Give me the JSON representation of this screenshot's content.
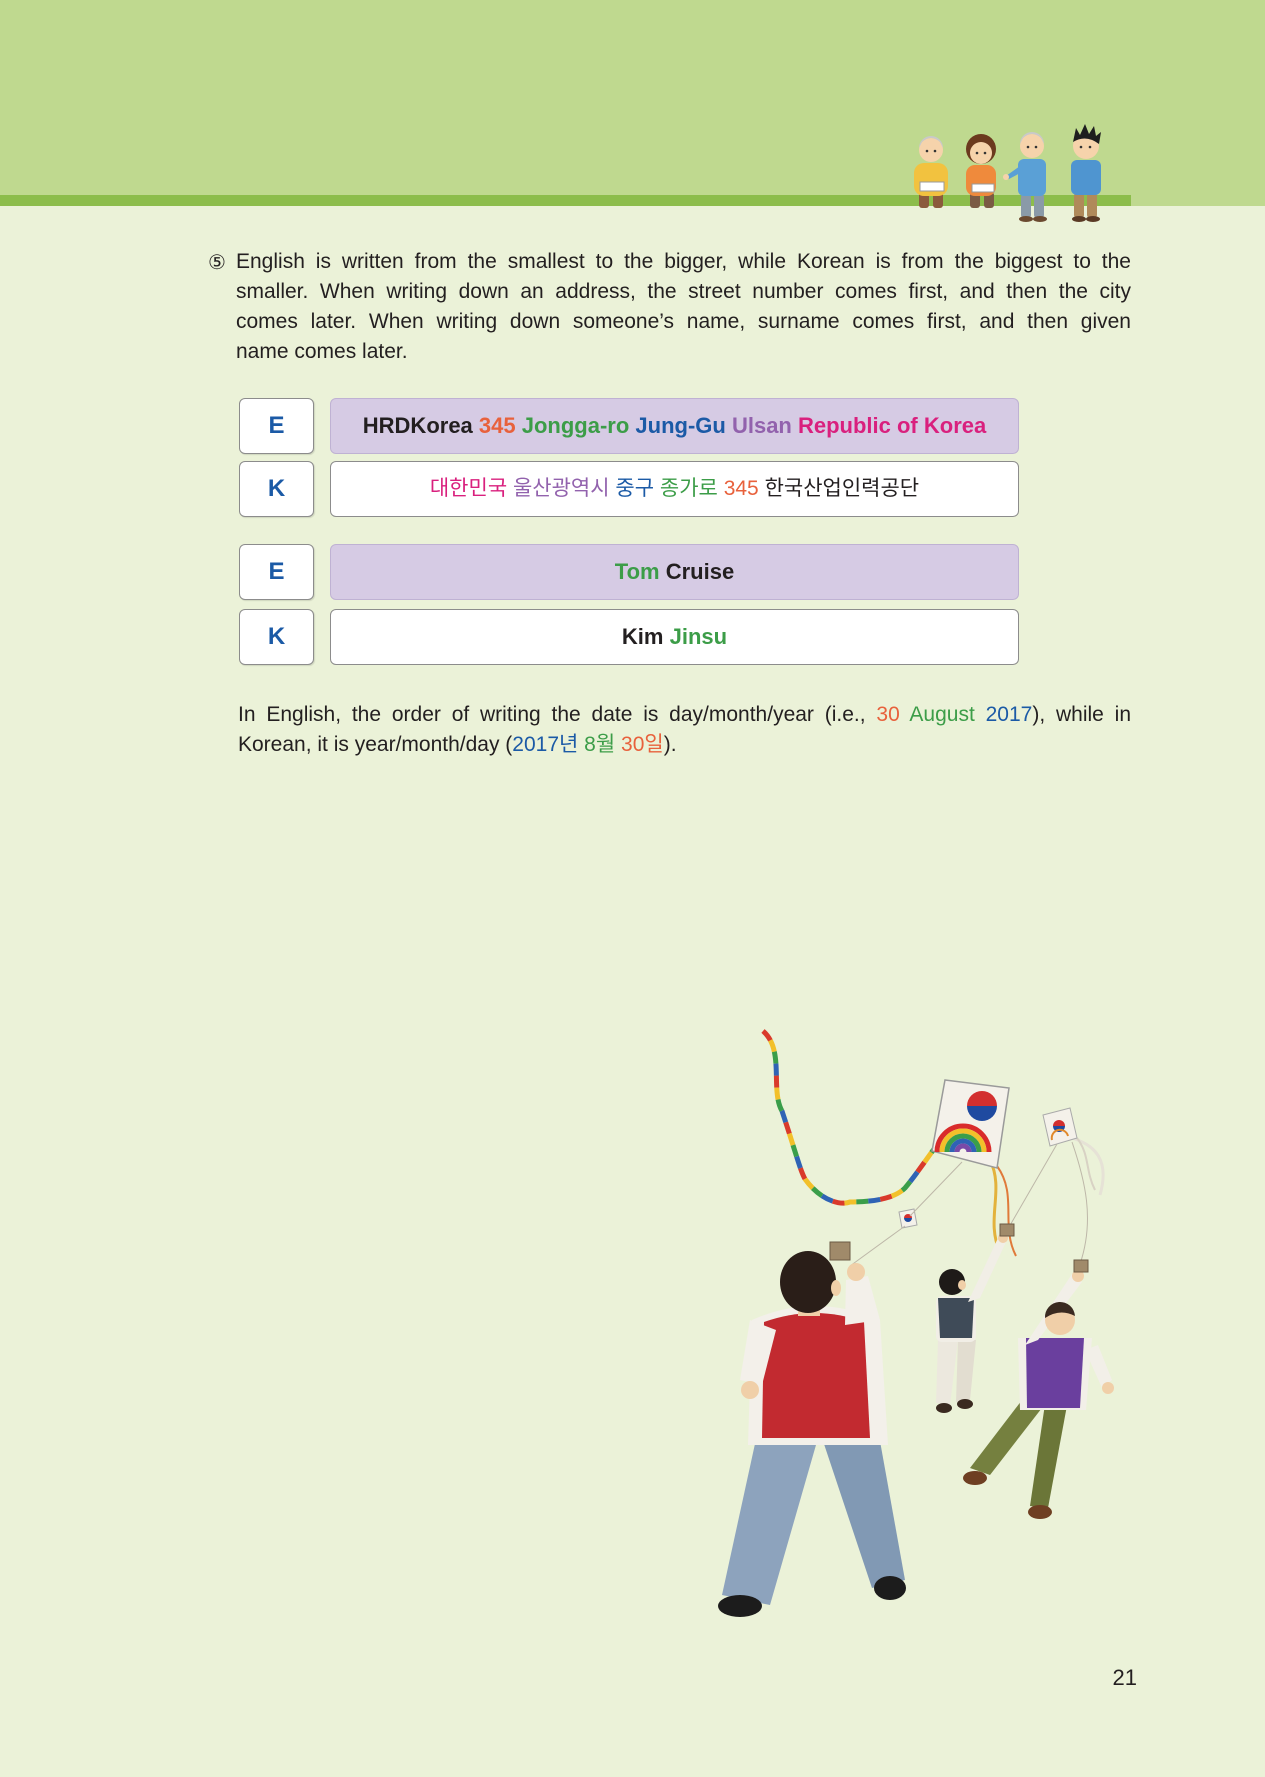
{
  "colors": {
    "page_background": "#ebf2d8",
    "header_band": "#bfd98f",
    "header_stripe": "#8cbd4b",
    "highlight_box": "#d6cbe4",
    "plain_box": "#ffffff",
    "label_letter": "#1b5aa6",
    "text": "#231f20"
  },
  "intro": {
    "marker": "⑤",
    "lines": [
      "English is written from the smallest to the bigger, while Korean is from the biggest to the",
      "smaller. When writing down an address, the street number comes first, and then the city",
      "comes later. When writing down someone’s name, surname comes first, and then given",
      "name comes later."
    ]
  },
  "comparison_table": {
    "rows": [
      {
        "label": "E",
        "segments": [
          {
            "text": "HRDKorea",
            "color": "#231f20"
          },
          {
            "text": " 345",
            "color": "#e8613c"
          },
          {
            "text": " Jongga-ro",
            "color": "#3c9d48"
          },
          {
            "text": " Jung-Gu",
            "color": "#1b5aa6"
          },
          {
            "text": " Ulsan",
            "color": "#9262ad"
          },
          {
            "text": " Republic of Korea",
            "color": "#d9207e"
          }
        ]
      },
      {
        "label": "K",
        "segments": [
          {
            "text": "대한민국",
            "color": "#d9207e"
          },
          {
            "text": " 울산광역시",
            "color": "#9262ad"
          },
          {
            "text": " 중구",
            "color": "#1b5aa6"
          },
          {
            "text": " 종가로",
            "color": "#3c9d48"
          },
          {
            "text": " 345",
            "color": "#e8613c"
          },
          {
            "text": " 한국산업인력공단",
            "color": "#231f20"
          }
        ]
      },
      {
        "label": "E",
        "segments": [
          {
            "text": "Tom",
            "color": "#3c9d48"
          },
          {
            "text": " Cruise",
            "color": "#231f20"
          }
        ]
      },
      {
        "label": "K",
        "segments": [
          {
            "text": "Kim",
            "color": "#231f20"
          },
          {
            "text": " Jinsu",
            "color": "#3c9d48"
          }
        ]
      }
    ]
  },
  "date_note": {
    "lines": [
      {
        "segments": [
          {
            "text": "In English, the order of writing the date is day/month/year (i.e., ",
            "color": "#231f20"
          },
          {
            "text": "30",
            "color": "#e8613c"
          },
          {
            "text": " August",
            "color": "#3c9d48"
          },
          {
            "text": " 2017",
            "color": "#1b5aa6"
          },
          {
            "text": "), while in",
            "color": "#231f20"
          }
        ]
      },
      {
        "segments": [
          {
            "text": "Korean, it is year/month/day (",
            "color": "#231f20"
          },
          {
            "text": "2017년",
            "color": "#1b5aa6"
          },
          {
            "text": " 8월",
            "color": "#3c9d48"
          },
          {
            "text": " 30일",
            "color": "#e8613c"
          },
          {
            "text": ").",
            "color": "#231f20"
          }
        ]
      }
    ]
  },
  "page_number": "21"
}
